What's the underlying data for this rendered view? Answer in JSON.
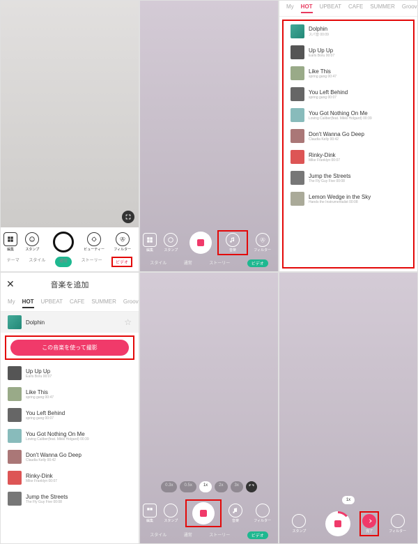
{
  "toolbar": {
    "grid": "編集",
    "stamp": "スタンプ",
    "beauty": "ビューティー",
    "filter": "フィルター",
    "music": "音楽",
    "complete": "完了"
  },
  "modes": {
    "theme": "テーマ",
    "style": "スタイル",
    "normal": "通常",
    "story": "ストーリー",
    "video": "ビデオ"
  },
  "music_header": {
    "title": "音楽を追加",
    "close": "✕"
  },
  "categories": {
    "my": "My",
    "hot": "HOT",
    "upbeat": "UPBEAT",
    "cafe": "CAFE",
    "summer": "SUMMER",
    "groove": "Groov"
  },
  "use_button": "この音楽を使って撮影",
  "speeds": {
    "s03": "0.3x",
    "s05": "0.5x",
    "s1": "1x",
    "s2": "2x",
    "s3": "3x"
  },
  "tracks": [
    {
      "name": "Dolphin",
      "meta": "スパ音  00:09"
    },
    {
      "name": "Up Up Up",
      "meta": "Earls Boru  00:07"
    },
    {
      "name": "Like This",
      "meta": "spring gang  00:47"
    },
    {
      "name": "You Left Behind",
      "meta": "spring gang  00:07"
    },
    {
      "name": "You Got Nothing On Me",
      "meta": "Loving Caliber(feat. Mikki Holgard)  00:39"
    },
    {
      "name": "Don't Wanna Go Deep",
      "meta": "Claudia Kelly  00:42"
    },
    {
      "name": "Rinky-Dink",
      "meta": "Mike Franklyn  00:07"
    },
    {
      "name": "Jump the Streets",
      "meta": "The Fly Guy Five  00:08"
    },
    {
      "name": "Lemon Wedge in the Sky",
      "meta": "Hands the Instrumentalist  00:08"
    }
  ]
}
